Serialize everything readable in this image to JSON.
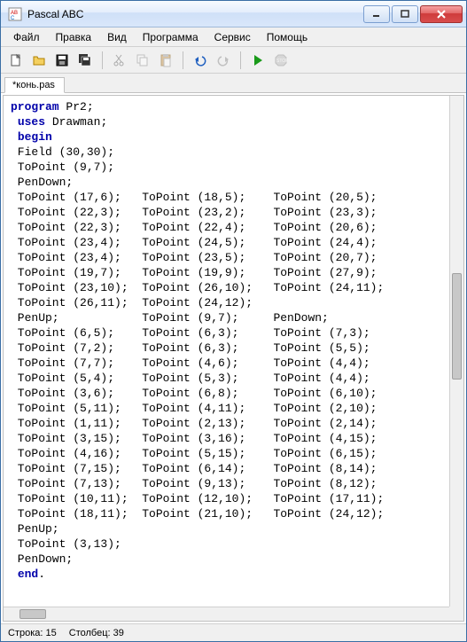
{
  "window": {
    "title": "Pascal ABC"
  },
  "menu": {
    "file": "Файл",
    "edit": "Правка",
    "view": "Вид",
    "program": "Программа",
    "service": "Сервис",
    "help": "Помощь"
  },
  "tab": {
    "name": "*конь.pas"
  },
  "status": {
    "line_label": "Строка:",
    "line_val": "15",
    "col_label": "Столбец:",
    "col_val": "39"
  },
  "code": {
    "k_program": "program",
    "prog_name": " Pr2;",
    "k_uses": "uses",
    "uses_name": " Drawman;",
    "k_begin": "begin",
    "lines": [
      "Field (30,30);",
      "ToPoint (9,7);",
      "PenDown;",
      "ToPoint (17,6);   ToPoint (18,5);    ToPoint (20,5);",
      "ToPoint (22,3);   ToPoint (23,2);    ToPoint (23,3);",
      "ToPoint (22,3);   ToPoint (22,4);    ToPoint (20,6);",
      "ToPoint (23,4);   ToPoint (24,5);    ToPoint (24,4);",
      "ToPoint (23,4);   ToPoint (23,5);    ToPoint (20,7);",
      "ToPoint (19,7);   ToPoint (19,9);    ToPoint (27,9);",
      "ToPoint (23,10);  ToPoint (26,10);   ToPoint (24,11);",
      "ToPoint (26,11);  ToPoint (24,12);",
      "PenUp;            ToPoint (9,7);     PenDown;",
      "ToPoint (6,5);    ToPoint (6,3);     ToPoint (7,3);",
      "ToPoint (7,2);    ToPoint (6,3);     ToPoint (5,5);",
      "ToPoint (7,7);    ToPoint (4,6);     ToPoint (4,4);",
      "ToPoint (5,4);    ToPoint (5,3);     ToPoint (4,4);",
      "ToPoint (3,6);    ToPoint (6,8);     ToPoint (6,10);",
      "ToPoint (5,11);   ToPoint (4,11);    ToPoint (2,10);",
      "ToPoint (1,11);   ToPoint (2,13);    ToPoint (2,14);",
      "ToPoint (3,15);   ToPoint (3,16);    ToPoint (4,15);",
      "ToPoint (4,16);   ToPoint (5,15);    ToPoint (6,15);",
      "ToPoint (7,15);   ToPoint (6,14);    ToPoint (8,14);",
      "ToPoint (7,13);   ToPoint (9,13);    ToPoint (8,12);",
      "ToPoint (10,11);  ToPoint (12,10);   ToPoint (17,11);",
      "ToPoint (18,11);  ToPoint (21,10);   ToPoint (24,12);",
      "PenUp;",
      "ToPoint (3,13);",
      "PenDown;"
    ],
    "k_end": "end"
  }
}
